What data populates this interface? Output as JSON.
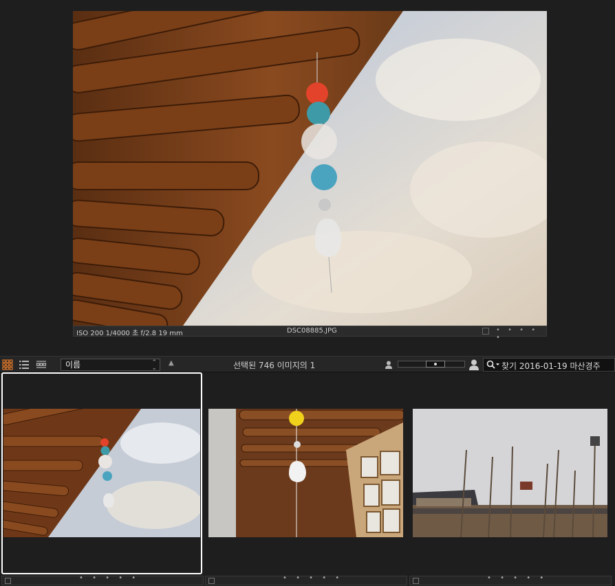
{
  "preview": {
    "meta": "ISO 200 1/4000 초 f/2.8 19 mm",
    "filename": "DSC08885.JPG",
    "dots": "• • • • •"
  },
  "toolbar": {
    "sort_value": "이름",
    "sort_dir": "▲",
    "selection_text": "선택된 746 이미지의 1",
    "search_icon": "search-icon",
    "search_text": "찾기 2016-01-19 마산경주"
  },
  "thumbnails": [
    {
      "selected": true,
      "dots": "• • • • •"
    },
    {
      "selected": false,
      "dots": "• • • • •"
    },
    {
      "selected": false,
      "dots": "• • • • •"
    }
  ],
  "colors": {
    "background": "#1e1e1e",
    "accent": "#e0782a",
    "selection_border": "#ffffff"
  }
}
